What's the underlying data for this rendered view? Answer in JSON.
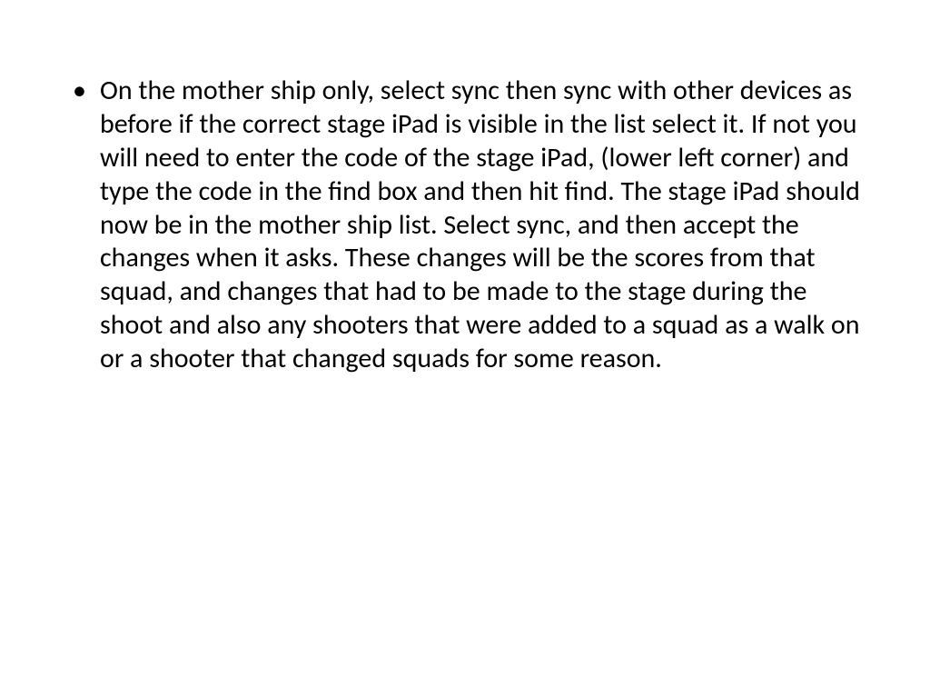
{
  "slide": {
    "bullets": [
      "On the mother ship only, select sync then sync with other devices as before if the correct stage iPad is visible in the list select it.  If not you will need to enter the code of the stage iPad, (lower left corner) and type the code in the find box and then hit find.  The stage iPad should now be in the mother ship list.  Select sync, and then accept the changes when it asks.  These changes will be the scores from that squad, and changes that had to be made to the stage during the shoot and also any shooters that were added to a squad as a walk on or a shooter that changed squads for some reason."
    ]
  }
}
